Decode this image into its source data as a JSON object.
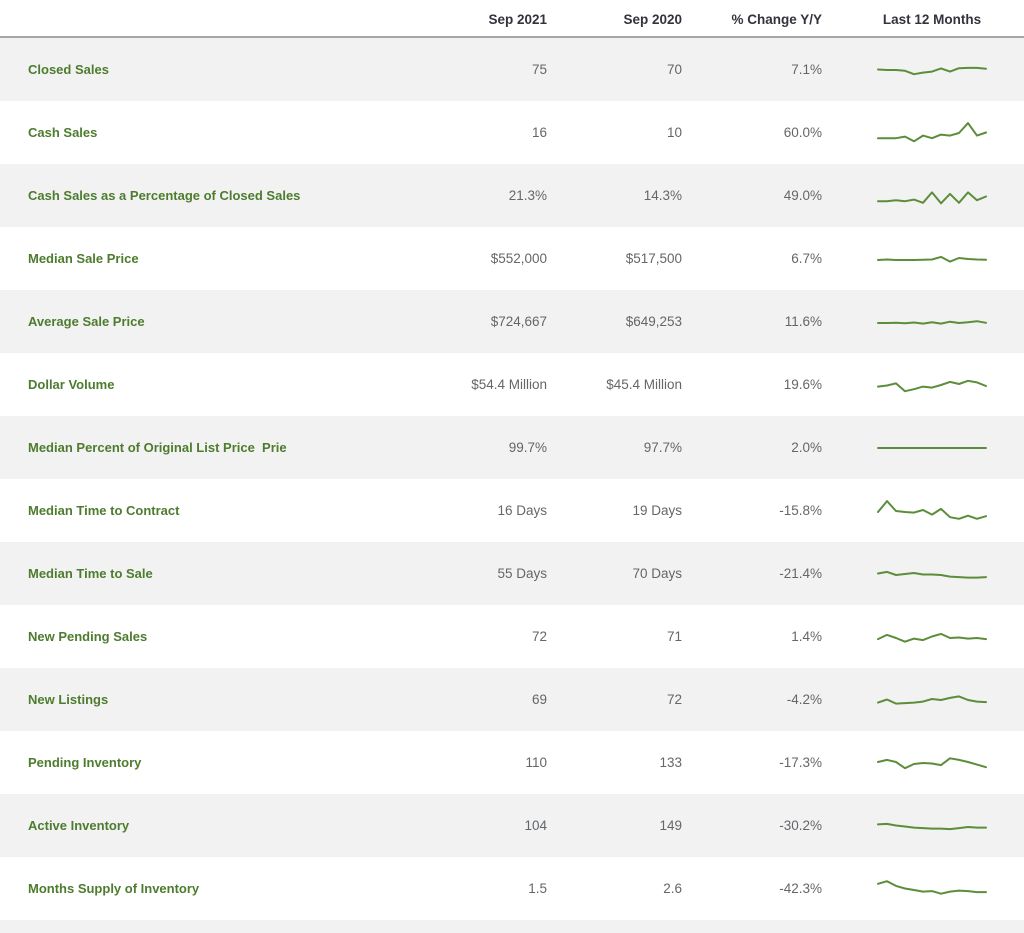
{
  "colors": {
    "label_green": "#4d7c2e",
    "sparkline_green": "#5b8d3a",
    "row_alt_bg": "#f2f2f2",
    "value_gray": "#63666a",
    "header_text": "#33333d",
    "header_border": "#a6a6aa"
  },
  "chart_data": {
    "type": "table",
    "columns": [
      "Sep 2021",
      "Sep 2020",
      "% Change Y/Y",
      "Last 12 Months"
    ],
    "sparkline_legend": "Last 12 Months",
    "sparkline_note": "sparkline values are normalized 0-100 estimates read from the pixel trace of each 12-month trend line",
    "rows": [
      {
        "label": "Closed Sales",
        "sep_2021": "75",
        "sep_2020": "70",
        "change_yoy": "7.1%",
        "sparkline": [
          52,
          50,
          50,
          47,
          34,
          40,
          44,
          56,
          44,
          57,
          58,
          58,
          55
        ]
      },
      {
        "label": "Cash Sales",
        "sep_2021": "16",
        "sep_2020": "10",
        "change_yoy": "60.0%",
        "sparkline": [
          30,
          30,
          30,
          36,
          18,
          40,
          30,
          44,
          40,
          50,
          88,
          40,
          52
        ]
      },
      {
        "label": "Cash Sales as a Percentage of Closed Sales",
        "sep_2021": "21.3%",
        "sep_2020": "14.3%",
        "change_yoy": "49.0%",
        "sparkline": [
          30,
          30,
          34,
          30,
          36,
          24,
          64,
          22,
          58,
          24,
          64,
          34,
          48
        ]
      },
      {
        "label": "Median Sale Price",
        "sep_2021": "$552,000",
        "sep_2020": "$517,500",
        "change_yoy": "6.7%",
        "sparkline": [
          46,
          48,
          46,
          46,
          46,
          47,
          48,
          58,
          40,
          54,
          50,
          48,
          47
        ]
      },
      {
        "label": "Average Sale Price",
        "sep_2021": "$724,667",
        "sep_2020": "$649,253",
        "change_yoy": "11.6%",
        "sparkline": [
          46,
          46,
          47,
          45,
          48,
          44,
          49,
          44,
          51,
          46,
          49,
          53,
          47
        ]
      },
      {
        "label": "Dollar Volume",
        "sep_2021": "$54.4 Million",
        "sep_2020": "$45.4 Million",
        "change_yoy": "19.6%",
        "sparkline": [
          44,
          48,
          56,
          26,
          34,
          44,
          40,
          50,
          62,
          54,
          66,
          60,
          46
        ]
      },
      {
        "label": "Median Percent of Original List Price  Prie",
        "sep_2021": "99.7%",
        "sep_2020": "97.7%",
        "change_yoy": "2.0%",
        "sparkline": [
          50,
          50,
          50,
          50,
          50,
          50,
          50,
          50,
          50,
          50,
          50,
          50,
          50
        ]
      },
      {
        "label": "Median Time to Contract",
        "sep_2021": "16 Days",
        "sep_2020": "19 Days",
        "change_yoy": "-15.8%",
        "sparkline": [
          46,
          88,
          50,
          46,
          44,
          54,
          36,
          58,
          26,
          20,
          32,
          20,
          30
        ]
      },
      {
        "label": "Median Time to Sale",
        "sep_2021": "55 Days",
        "sep_2020": "70 Days",
        "change_yoy": "-21.4%",
        "sparkline": [
          52,
          58,
          46,
          50,
          54,
          48,
          48,
          46,
          40,
          38,
          36,
          36,
          38
        ]
      },
      {
        "label": "New Pending Sales",
        "sep_2021": "72",
        "sep_2020": "71",
        "change_yoy": "1.4%",
        "sparkline": [
          42,
          58,
          46,
          32,
          44,
          38,
          52,
          62,
          46,
          48,
          44,
          46,
          42
        ]
      },
      {
        "label": "New Listings",
        "sep_2021": "69",
        "sep_2020": "72",
        "change_yoy": "-4.2%",
        "sparkline": [
          40,
          52,
          36,
          38,
          40,
          44,
          54,
          50,
          58,
          64,
          50,
          44,
          42
        ]
      },
      {
        "label": "Pending Inventory",
        "sep_2021": "110",
        "sep_2020": "133",
        "change_yoy": "-17.3%",
        "sparkline": [
          54,
          62,
          54,
          30,
          46,
          50,
          48,
          42,
          68,
          62,
          54,
          44,
          34
        ]
      },
      {
        "label": "Active Inventory",
        "sep_2021": "104",
        "sep_2020": "149",
        "change_yoy": "-30.2%",
        "sparkline": [
          56,
          58,
          52,
          48,
          44,
          42,
          40,
          40,
          38,
          42,
          46,
          44,
          44
        ]
      },
      {
        "label": "Months Supply of Inventory",
        "sep_2021": "1.5",
        "sep_2020": "2.6",
        "change_yoy": "-42.3%",
        "sparkline": [
          70,
          80,
          62,
          52,
          46,
          40,
          42,
          32,
          40,
          44,
          42,
          38,
          38
        ]
      }
    ]
  }
}
